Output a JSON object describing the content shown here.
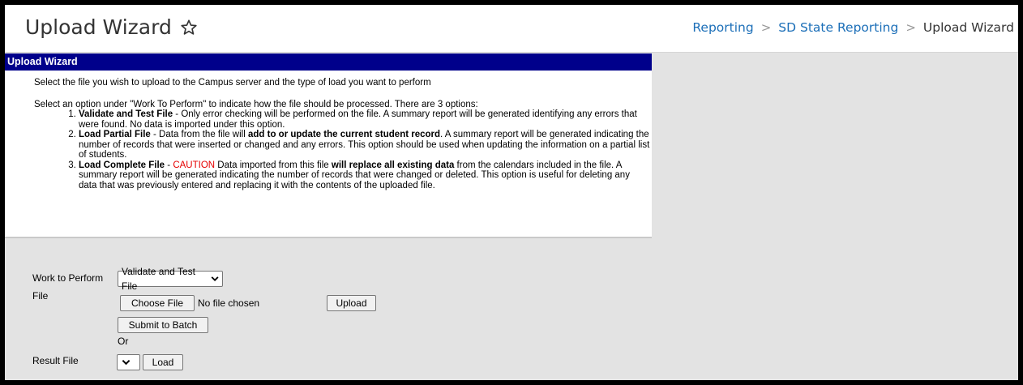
{
  "header": {
    "title": "Upload Wizard",
    "breadcrumb": [
      "Reporting",
      "SD State Reporting",
      "Upload Wizard"
    ]
  },
  "panel": {
    "title": "Upload Wizard",
    "intro": "Select the file you wish to upload to the Campus server and the type of load you want to perform",
    "options_intro": "Select an option under \"Work To Perform\" to indicate how the file should be processed. There are 3 options:",
    "option1": {
      "name": "Validate and Test File",
      "desc": " - Only error checking will be performed on the file. A summary report will be generated identifying any errors that were found. No data is imported under this option."
    },
    "option2": {
      "name": "Load Partial File",
      "desc_a": " - Data from the file will ",
      "bold": "add to or update the current student record",
      "desc_b": ". A summary report will be generated indicating the number of records that were inserted or changed and any errors. This option should be used when updating the information on a partial list of students."
    },
    "option3": {
      "name": "Load Complete File",
      "dash": " - ",
      "caution": "CAUTION",
      "desc_a": " Data imported from this file ",
      "bold": "will replace all existing data",
      "desc_b": " from the calendars included in the file. A summary report will be generated indicating the number of records that were changed or deleted. This option is useful for deleting any data that was previously entered and replacing it with the contents of the uploaded file."
    }
  },
  "form": {
    "work_label": "Work to Perform",
    "work_value": "Validate and Test File",
    "file_label": "File",
    "choose_file": "Choose File",
    "no_file": "No file chosen",
    "upload": "Upload",
    "submit_batch": "Submit to Batch",
    "or": "Or",
    "result_label": "Result File",
    "result_value": "",
    "load": "Load"
  },
  "colors": {
    "titlebar": "#00008b",
    "link": "#1c6fb8",
    "caution": "#e60000"
  }
}
